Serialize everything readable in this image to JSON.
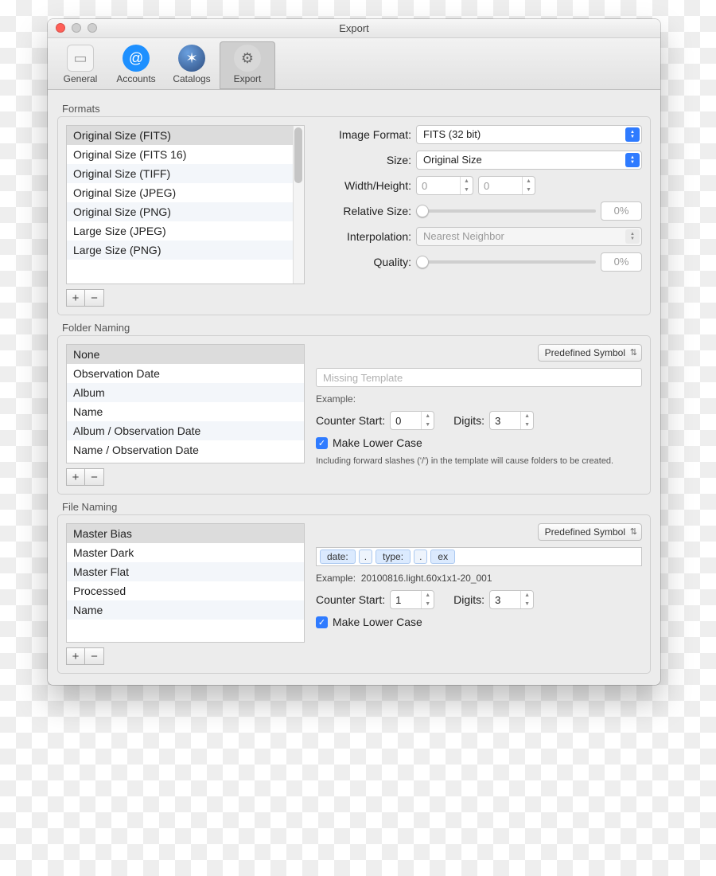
{
  "window": {
    "title": "Export"
  },
  "toolbar": {
    "general": "General",
    "accounts": "Accounts",
    "catalogs": "Catalogs",
    "export": "Export"
  },
  "formats": {
    "section_label": "Formats",
    "items": [
      "Original Size (FITS)",
      "Original Size (FITS 16)",
      "Original Size (TIFF)",
      "Original Size (JPEG)",
      "Original Size (PNG)",
      "Large Size (JPEG)",
      "Large Size (PNG)"
    ],
    "labels": {
      "image_format": "Image Format:",
      "size": "Size:",
      "wh": "Width/Height:",
      "relsize": "Relative Size:",
      "interpolation": "Interpolation:",
      "quality": "Quality:"
    },
    "image_format_value": "FITS (32 bit)",
    "size_value": "Original Size",
    "width_value": "0",
    "height_value": "0",
    "relsize_value": "0%",
    "interpolation_value": "Nearest Neighbor",
    "quality_value": "0%"
  },
  "folder": {
    "section_label": "Folder Naming",
    "items": [
      "None",
      "Observation Date",
      "Album",
      "Name",
      "Album / Observation Date",
      "Name / Observation Date"
    ],
    "predef_label": "Predefined Symbol",
    "template_placeholder": "Missing Template",
    "example_label": "Example:",
    "counter_start_label": "Counter Start:",
    "counter_start_value": "0",
    "digits_label": "Digits:",
    "digits_value": "3",
    "lowercase_label": "Make Lower Case",
    "hint": "Including forward slashes ('/') in the template will cause folders to be created."
  },
  "file": {
    "section_label": "File Naming",
    "items": [
      "Master Bias",
      "Master Dark",
      "Master Flat",
      "Processed",
      "Name"
    ],
    "predef_label": "Predefined Symbol",
    "tokens": [
      "date:",
      ".",
      "type:",
      ".",
      "ex"
    ],
    "example_label": "Example:",
    "example_value": "20100816.light.60x1x1-20_001",
    "counter_start_label": "Counter Start:",
    "counter_start_value": "1",
    "digits_label": "Digits:",
    "digits_value": "3",
    "lowercase_label": "Make Lower Case"
  },
  "buttons": {
    "plus": "+",
    "minus": "−"
  }
}
